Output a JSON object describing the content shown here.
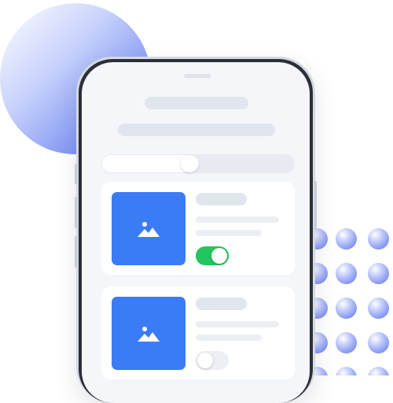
{
  "colors": {
    "accent_blue": "#3b7cf6",
    "toggle_on": "#22c55e",
    "toggle_off": "#eceff3",
    "screen_bg": "#f4f6f9",
    "skeleton": "#e1e6ee"
  },
  "segmented_control": {
    "position_fraction": 0.5
  },
  "cards": [
    {
      "image_icon": "image-placeholder-icon",
      "toggle_on": true
    },
    {
      "image_icon": "image-placeholder-icon",
      "toggle_on": false
    }
  ]
}
